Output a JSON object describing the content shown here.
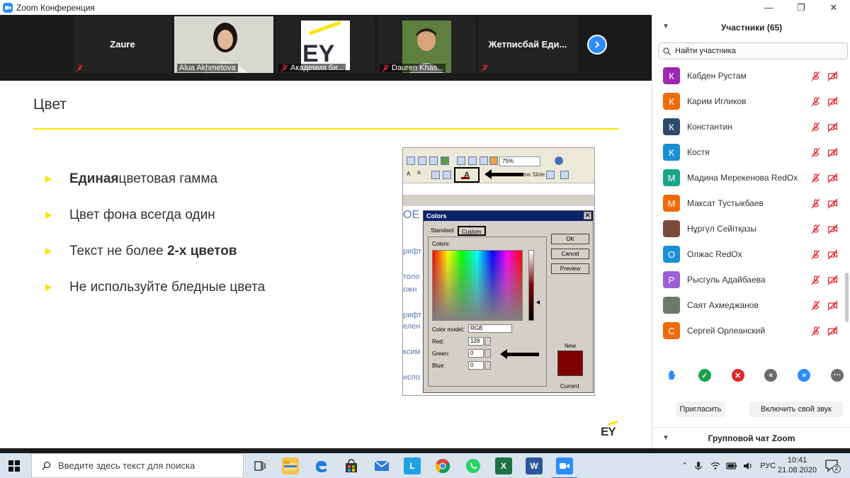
{
  "window": {
    "title": "Zoom Конференция",
    "controls": [
      "—",
      "❐",
      "✕"
    ]
  },
  "video_strip": {
    "tiles": [
      {
        "name": "Zaure",
        "caption": ""
      },
      {
        "name": "",
        "caption": "Alua Akhmetova"
      },
      {
        "name": "",
        "caption": "Академия би..."
      },
      {
        "name": "",
        "caption": "Dauren Khas..."
      },
      {
        "name": "Жетписбай  Еди...",
        "caption": ""
      }
    ],
    "tile_logo_text": "EY"
  },
  "slide": {
    "title": "Цвет",
    "bullets": [
      {
        "bold": "Единая",
        "text": " цветовая гамма"
      },
      {
        "bold": "",
        "text": "Цвет фона всегда один"
      },
      {
        "pre": "Текст не более ",
        "bold": "2-х цветов"
      },
      {
        "bold": "",
        "text": "Не используйте бледные цвета"
      }
    ],
    "logo": "EY",
    "embedded": {
      "zoom_value": "75%",
      "slide_text_fragment": "ew Slide",
      "bg_fragments": [
        "ОЕ",
        "рифт",
        "толо",
        "ожн",
        "рифт",
        "елен",
        "ксим",
        "испо"
      ],
      "dialog": {
        "title": "Colors",
        "tabs": [
          "Standard",
          "Custom"
        ],
        "colors_label": "Colors:",
        "buttons": [
          "OK",
          "Cancel",
          "Preview"
        ],
        "color_model_label": "Color model:",
        "color_model": "RGB",
        "red_label": "Red:",
        "green_label": "Green:",
        "blue_label": "Blue:",
        "red": "128",
        "green": "0",
        "blue": "0",
        "new_label": "New",
        "current_label": "Current"
      }
    }
  },
  "participants": {
    "header": "Участники (65)",
    "search_placeholder": "Найти участника",
    "list": [
      {
        "initial": "К",
        "name": "Кабден Рустам",
        "color": "#9c27b0"
      },
      {
        "initial": "К",
        "name": "Карим Игликов",
        "color": "#f06a0c"
      },
      {
        "initial": "К",
        "name": "Константин",
        "color": "#2c4a6b"
      },
      {
        "initial": "К",
        "name": "Костя",
        "color": "#1a8fd6"
      },
      {
        "initial": "М",
        "name": "Мадина Мерекенова RedOx",
        "color": "#17a589"
      },
      {
        "initial": "М",
        "name": "Максат Тустыкбаев",
        "color": "#f06a0c"
      },
      {
        "initial": "",
        "name": "Нұргүл Сейітқазы",
        "color": "#7a4b3a"
      },
      {
        "initial": "О",
        "name": "Олжас RedOx",
        "color": "#1a8fd6"
      },
      {
        "initial": "Р",
        "name": "Рысгуль Адайбаева",
        "color": "#9c5fd6"
      },
      {
        "initial": "",
        "name": "Саят Ахмеджанов",
        "color": "#6b7a6a"
      },
      {
        "initial": "С",
        "name": "Сергей Орлеанский",
        "color": "#f06a0c"
      }
    ],
    "invite_button": "Пригласить",
    "unmute_button": "Включить свой звук",
    "chat_header": "Групповой чат Zoom"
  },
  "taskbar": {
    "search_placeholder": "Введите здесь текст для поиска",
    "language": "РУС",
    "time": "10:41",
    "date": "21.08.2020",
    "notifications": "2"
  },
  "colors": {
    "accent_yellow": "#ffe600",
    "zoom_blue": "#2d8cff",
    "muted_red": "#e0282e"
  }
}
